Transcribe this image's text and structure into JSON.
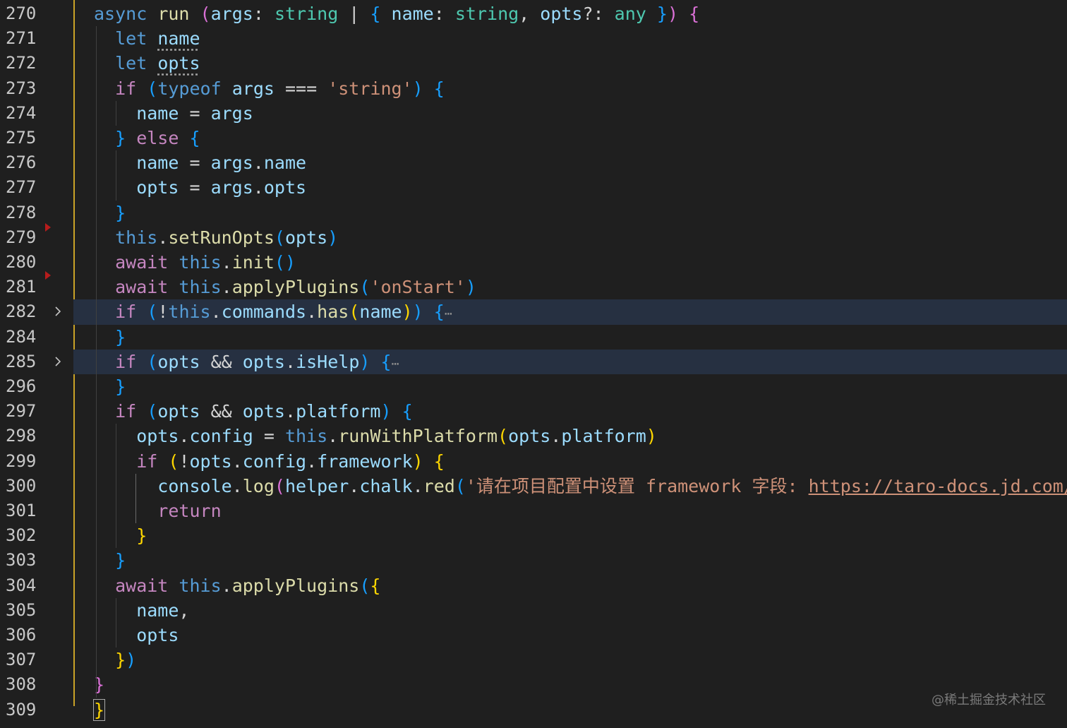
{
  "editor": {
    "theme": "dark",
    "colors": {
      "background": "#1f1f1f",
      "folded_line_highlight": "#263041",
      "line_number": "#c8c8c8",
      "scope_indicator": "#c9a227",
      "breakpoint_marker": "#b71c1c"
    },
    "watermark": "@稀土掘金技术社区",
    "folded_lines": [
      "282",
      "285"
    ],
    "line_numbers": [
      "270",
      "271",
      "272",
      "273",
      "274",
      "275",
      "276",
      "277",
      "278",
      "279",
      "280",
      "281",
      "282",
      "284",
      "285",
      "296",
      "297",
      "298",
      "299",
      "300",
      "301",
      "302",
      "303",
      "304",
      "305",
      "306",
      "307",
      "308",
      "309"
    ],
    "lines": [
      {
        "ln": "270",
        "tokens": [
          [
            "async",
            "kw-decl"
          ],
          [
            " ",
            ""
          ],
          [
            "run",
            "fn"
          ],
          [
            " ",
            ""
          ],
          [
            "(",
            "b2"
          ],
          [
            "args",
            "ident"
          ],
          [
            ": ",
            "punc"
          ],
          [
            "string",
            "type"
          ],
          [
            " | ",
            "punc"
          ],
          [
            "{",
            "b3"
          ],
          [
            " ",
            ""
          ],
          [
            "name",
            "ident"
          ],
          [
            ": ",
            "punc"
          ],
          [
            "string",
            "type"
          ],
          [
            ", ",
            "punc"
          ],
          [
            "opts",
            "ident"
          ],
          [
            "?: ",
            "punc"
          ],
          [
            "any",
            "type"
          ],
          [
            " ",
            ""
          ],
          [
            "}",
            "b3"
          ],
          [
            ")",
            "b2"
          ],
          [
            " ",
            ""
          ],
          [
            "{",
            "b2"
          ]
        ]
      },
      {
        "ln": "271",
        "tokens": [
          [
            "  let ",
            "kw-decl"
          ],
          [
            "name",
            "ident dots"
          ]
        ]
      },
      {
        "ln": "272",
        "tokens": [
          [
            "  let ",
            "kw-decl"
          ],
          [
            "opts",
            "ident dots"
          ]
        ]
      },
      {
        "ln": "273",
        "tokens": [
          [
            "  if",
            "kw-ctrl"
          ],
          [
            " ",
            ""
          ],
          [
            "(",
            "b3"
          ],
          [
            "typeof",
            "kw-decl"
          ],
          [
            " ",
            ""
          ],
          [
            "args",
            "ident"
          ],
          [
            " === ",
            "punc"
          ],
          [
            "'string'",
            "str"
          ],
          [
            ")",
            "b3"
          ],
          [
            " ",
            ""
          ],
          [
            "{",
            "b3"
          ]
        ]
      },
      {
        "ln": "274",
        "tokens": [
          [
            "    name",
            "ident"
          ],
          [
            " = ",
            "punc"
          ],
          [
            "args",
            "ident"
          ]
        ]
      },
      {
        "ln": "275",
        "tokens": [
          [
            "  }",
            "b3"
          ],
          [
            " else ",
            "kw-ctrl"
          ],
          [
            "{",
            "b3"
          ]
        ]
      },
      {
        "ln": "276",
        "tokens": [
          [
            "    name",
            "ident"
          ],
          [
            " = ",
            "punc"
          ],
          [
            "args",
            "ident"
          ],
          [
            ".",
            "punc"
          ],
          [
            "name",
            "ident"
          ]
        ]
      },
      {
        "ln": "277",
        "tokens": [
          [
            "    opts",
            "ident"
          ],
          [
            " = ",
            "punc"
          ],
          [
            "args",
            "ident"
          ],
          [
            ".",
            "punc"
          ],
          [
            "opts",
            "ident"
          ]
        ]
      },
      {
        "ln": "278",
        "tokens": [
          [
            "  }",
            "b3"
          ]
        ]
      },
      {
        "ln": "279",
        "tokens": [
          [
            "  this",
            "kw-decl"
          ],
          [
            ".",
            "punc"
          ],
          [
            "setRunOpts",
            "fn"
          ],
          [
            "(",
            "b3"
          ],
          [
            "opts",
            "ident"
          ],
          [
            ")",
            "b3"
          ]
        ]
      },
      {
        "ln": "280",
        "tokens": [
          [
            "  await",
            "kw-ctrl"
          ],
          [
            " ",
            ""
          ],
          [
            "this",
            "kw-decl"
          ],
          [
            ".",
            "punc"
          ],
          [
            "init",
            "fn"
          ],
          [
            "()",
            "b3"
          ]
        ]
      },
      {
        "ln": "281",
        "tokens": [
          [
            "  await",
            "kw-ctrl"
          ],
          [
            " ",
            ""
          ],
          [
            "this",
            "kw-decl"
          ],
          [
            ".",
            "punc"
          ],
          [
            "applyPlugins",
            "fn"
          ],
          [
            "(",
            "b3"
          ],
          [
            "'onStart'",
            "str"
          ],
          [
            ")",
            "b3"
          ]
        ]
      },
      {
        "ln": "282",
        "tokens": [
          [
            "  if",
            "kw-ctrl"
          ],
          [
            " ",
            ""
          ],
          [
            "(",
            "b3"
          ],
          [
            "!",
            "punc"
          ],
          [
            "this",
            "kw-decl"
          ],
          [
            ".",
            "punc"
          ],
          [
            "commands",
            "ident"
          ],
          [
            ".",
            "punc"
          ],
          [
            "has",
            "fn"
          ],
          [
            "(",
            "b1"
          ],
          [
            "name",
            "ident"
          ],
          [
            ")",
            "b1"
          ],
          [
            ")",
            "b3"
          ],
          [
            " ",
            ""
          ],
          [
            "{",
            "b3"
          ],
          [
            "⋯",
            "ellipsis"
          ]
        ]
      },
      {
        "ln": "284",
        "tokens": [
          [
            "  }",
            "b3"
          ]
        ]
      },
      {
        "ln": "285",
        "tokens": [
          [
            "  if",
            "kw-ctrl"
          ],
          [
            " ",
            ""
          ],
          [
            "(",
            "b3"
          ],
          [
            "opts",
            "ident"
          ],
          [
            " && ",
            "punc"
          ],
          [
            "opts",
            "ident"
          ],
          [
            ".",
            "punc"
          ],
          [
            "isHelp",
            "ident"
          ],
          [
            ")",
            "b3"
          ],
          [
            " ",
            ""
          ],
          [
            "{",
            "b3"
          ],
          [
            "⋯",
            "ellipsis"
          ]
        ]
      },
      {
        "ln": "296",
        "tokens": [
          [
            "  }",
            "b3"
          ]
        ]
      },
      {
        "ln": "297",
        "tokens": [
          [
            "  if",
            "kw-ctrl"
          ],
          [
            " ",
            ""
          ],
          [
            "(",
            "b3"
          ],
          [
            "opts",
            "ident"
          ],
          [
            " && ",
            "punc"
          ],
          [
            "opts",
            "ident"
          ],
          [
            ".",
            "punc"
          ],
          [
            "platform",
            "ident"
          ],
          [
            ")",
            "b3"
          ],
          [
            " ",
            ""
          ],
          [
            "{",
            "b3"
          ]
        ]
      },
      {
        "ln": "298",
        "tokens": [
          [
            "    opts",
            "ident"
          ],
          [
            ".",
            "punc"
          ],
          [
            "config",
            "ident"
          ],
          [
            " = ",
            "punc"
          ],
          [
            "this",
            "kw-decl"
          ],
          [
            ".",
            "punc"
          ],
          [
            "runWithPlatform",
            "fn"
          ],
          [
            "(",
            "b1"
          ],
          [
            "opts",
            "ident"
          ],
          [
            ".",
            "punc"
          ],
          [
            "platform",
            "ident"
          ],
          [
            ")",
            "b1"
          ]
        ]
      },
      {
        "ln": "299",
        "tokens": [
          [
            "    if",
            "kw-ctrl"
          ],
          [
            " ",
            ""
          ],
          [
            "(",
            "b1"
          ],
          [
            "!",
            "punc"
          ],
          [
            "opts",
            "ident"
          ],
          [
            ".",
            "punc"
          ],
          [
            "config",
            "ident"
          ],
          [
            ".",
            "punc"
          ],
          [
            "framework",
            "ident"
          ],
          [
            ")",
            "b1"
          ],
          [
            " ",
            ""
          ],
          [
            "{",
            "b1"
          ]
        ]
      },
      {
        "ln": "300",
        "tokens": [
          [
            "      console",
            "ident"
          ],
          [
            ".",
            "punc"
          ],
          [
            "log",
            "fn"
          ],
          [
            "(",
            "b2"
          ],
          [
            "helper",
            "ident"
          ],
          [
            ".",
            "punc"
          ],
          [
            "chalk",
            "ident"
          ],
          [
            ".",
            "punc"
          ],
          [
            "red",
            "fn"
          ],
          [
            "(",
            "b3"
          ],
          [
            "'请在项目配置中设置 framework 字段: ",
            "str"
          ],
          [
            "https://taro-docs.jd.com/taro/d",
            "link"
          ]
        ]
      },
      {
        "ln": "301",
        "tokens": [
          [
            "      return",
            "kw-ctrl"
          ]
        ]
      },
      {
        "ln": "302",
        "tokens": [
          [
            "    }",
            "b1"
          ]
        ]
      },
      {
        "ln": "303",
        "tokens": [
          [
            "  }",
            "b3"
          ]
        ]
      },
      {
        "ln": "304",
        "tokens": [
          [
            "  await",
            "kw-ctrl"
          ],
          [
            " ",
            ""
          ],
          [
            "this",
            "kw-decl"
          ],
          [
            ".",
            "punc"
          ],
          [
            "applyPlugins",
            "fn"
          ],
          [
            "(",
            "b3"
          ],
          [
            "{",
            "b1"
          ]
        ]
      },
      {
        "ln": "305",
        "tokens": [
          [
            "    name",
            "ident"
          ],
          [
            ",",
            "punc"
          ]
        ]
      },
      {
        "ln": "306",
        "tokens": [
          [
            "    opts",
            "ident"
          ]
        ]
      },
      {
        "ln": "307",
        "tokens": [
          [
            "  }",
            "b1"
          ],
          [
            ")",
            "b3"
          ]
        ]
      },
      {
        "ln": "308",
        "tokens": [
          [
            "}",
            "b2"
          ]
        ]
      },
      {
        "ln": "309",
        "tokens": [
          [
            "}",
            "b1 cursor-brace"
          ]
        ]
      }
    ]
  }
}
